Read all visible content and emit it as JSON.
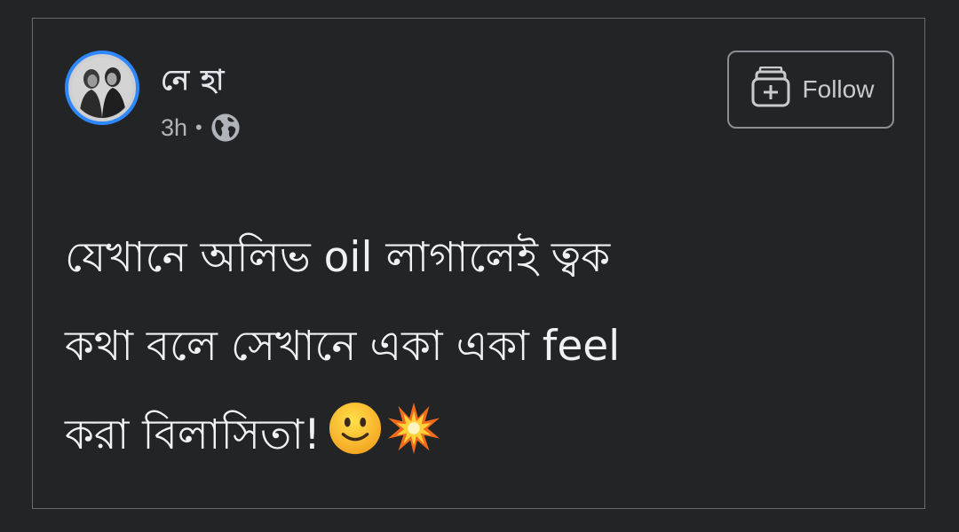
{
  "post": {
    "author_name": "নে হা",
    "timestamp": "3h",
    "separator": "•",
    "privacy_icon": "globe-icon",
    "follow_label": "Follow",
    "follow_icon": "follow-plus-icon",
    "text_lines": [
      "যেখানে অলিভ oil লাগালেই ত্বক",
      "কথা বলে সেখানে একা একা feel",
      "করা বিলাসিতা!"
    ],
    "emojis": [
      "slightly-smiling-face-emoji",
      "collision-emoji"
    ]
  },
  "colors": {
    "background": "#232425",
    "card_border": "#6a6b6d",
    "avatar_ring": "#2d88ff",
    "text_primary": "#f0f1f3",
    "text_secondary": "#b0b3b8"
  }
}
